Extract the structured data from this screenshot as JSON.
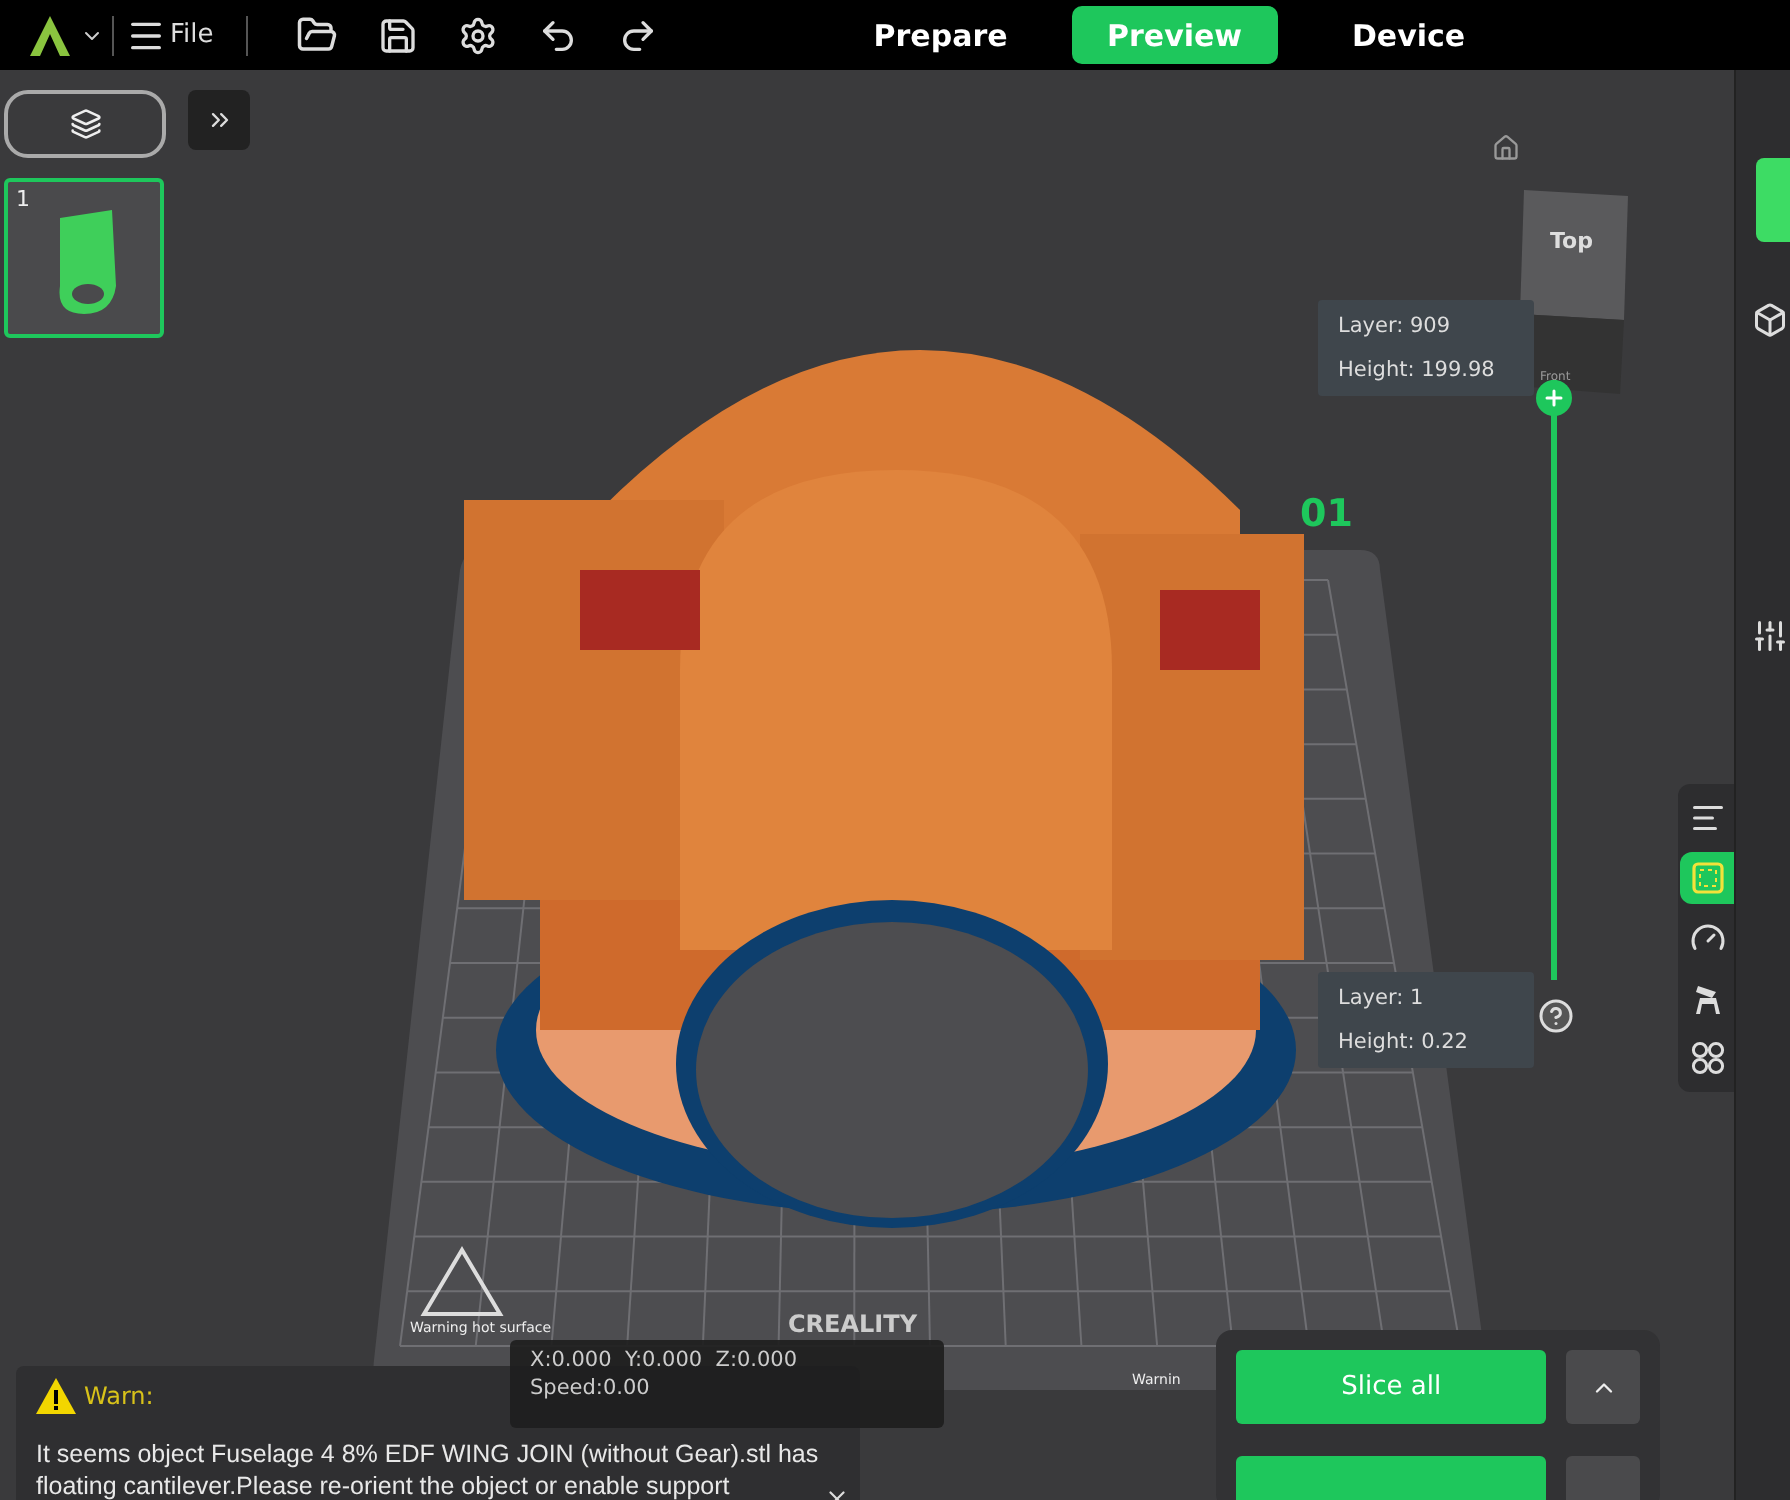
{
  "toolbar": {
    "menu_label": "File",
    "tabs": [
      {
        "label": "Prepare",
        "selected": false
      },
      {
        "label": "Preview",
        "selected": true
      },
      {
        "label": "Device",
        "selected": false
      }
    ]
  },
  "plates": [
    {
      "number": "1",
      "selected": true
    }
  ],
  "scene": {
    "plate_label": "01",
    "hot_surface_warning": "Warning hot surface",
    "brand": "CREALITY",
    "second_warning": "Warnin",
    "cube_top": "Top",
    "cube_front": "Front"
  },
  "layer_slider": {
    "level": 1,
    "top": {
      "layer": "Layer: 909",
      "height": "Height: 199.98"
    },
    "bottom": {
      "layer": "Layer: 1",
      "height": "Height: 0.22"
    }
  },
  "side_tools": [
    {
      "kind": "layers",
      "selected": false
    },
    {
      "kind": "frame",
      "selected": true
    },
    {
      "kind": "speed",
      "selected": false
    },
    {
      "kind": "support",
      "selected": false
    },
    {
      "kind": "clover",
      "selected": false
    }
  ],
  "coordinates": {
    "position": "X:0.000  Y:0.000  Z:0.000",
    "speed": "Speed:0.00"
  },
  "warning": {
    "title": "Warn:",
    "message": "It seems object Fuselage 4 8% EDF WING JOIN (without Gear).stl has floating cantilever.Please re-orient the object or enable support"
  },
  "slice": {
    "button": "Slice all"
  }
}
